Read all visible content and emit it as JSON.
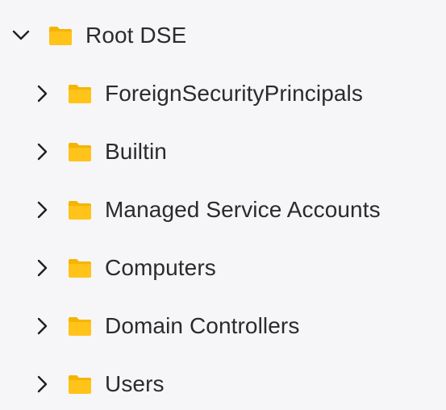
{
  "colors": {
    "background": "#f6f6f8",
    "folder_fill": "#ffc31a",
    "folder_tab": "#f5b400",
    "text": "#2b2b2b",
    "chevron": "#1f1f1f"
  },
  "tree": {
    "root": {
      "label": "Root DSE",
      "expanded": true,
      "icon": "folder-icon",
      "chevron_icon": "chevron-down-icon"
    },
    "children": [
      {
        "label": "ForeignSecurityPrincipals",
        "expanded": false,
        "icon": "folder-icon",
        "chevron_icon": "chevron-right-icon"
      },
      {
        "label": "Builtin",
        "expanded": false,
        "icon": "folder-icon",
        "chevron_icon": "chevron-right-icon"
      },
      {
        "label": "Managed Service Accounts",
        "expanded": false,
        "icon": "folder-icon",
        "chevron_icon": "chevron-right-icon"
      },
      {
        "label": "Computers",
        "expanded": false,
        "icon": "folder-icon",
        "chevron_icon": "chevron-right-icon"
      },
      {
        "label": "Domain Controllers",
        "expanded": false,
        "icon": "folder-icon",
        "chevron_icon": "chevron-right-icon"
      },
      {
        "label": "Users",
        "expanded": false,
        "icon": "folder-icon",
        "chevron_icon": "chevron-right-icon"
      }
    ]
  }
}
